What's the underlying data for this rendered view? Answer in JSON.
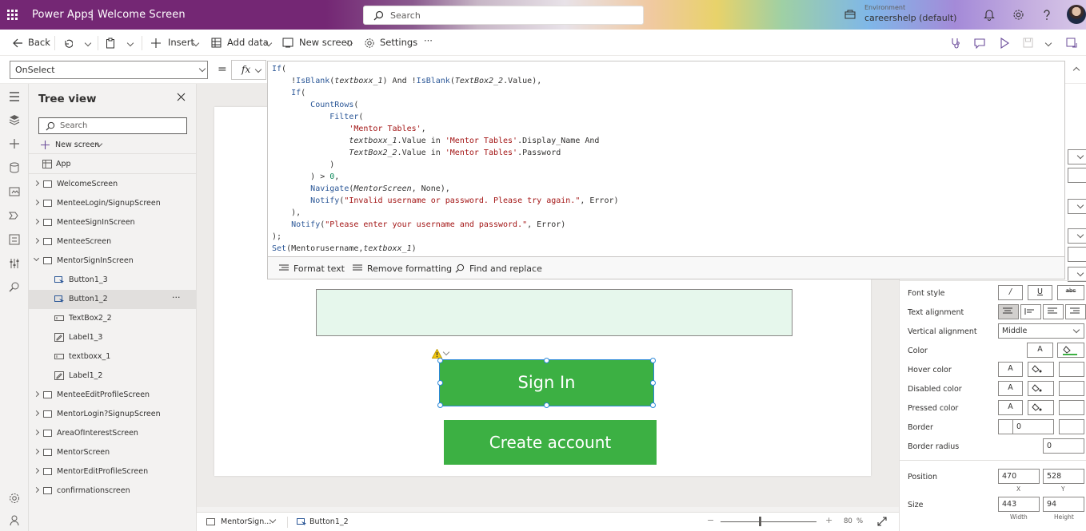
{
  "titlebar": {
    "app_name": "Power Apps",
    "separator": "|",
    "screen_name": "Welcome Screen",
    "search_placeholder": "Search",
    "environment_label": "Environment",
    "environment_value": "careershelp (default)"
  },
  "cmdbar": {
    "back": "Back",
    "insert": "Insert",
    "add_data": "Add data",
    "new_screen": "New screen",
    "settings": "Settings",
    "more": "···"
  },
  "formula": {
    "property": "OnSelect",
    "equals": "=",
    "fx": "fx",
    "format_text": "Format text",
    "remove_formatting": "Remove formatting",
    "find_replace": "Find and replace"
  },
  "tree": {
    "title": "Tree view",
    "search_placeholder": "Search",
    "new_screen": "New screen",
    "app": "App",
    "items": [
      {
        "label": "WelcomeScreen",
        "type": "screen"
      },
      {
        "label": "MenteeLogin/SignupScreen",
        "type": "screen"
      },
      {
        "label": "MenteeSignInScreen",
        "type": "screen"
      },
      {
        "label": "MenteeScreen",
        "type": "screen"
      },
      {
        "label": "MentorSignInScreen",
        "type": "screen-open"
      },
      {
        "label": "Button1_3",
        "type": "button"
      },
      {
        "label": "Button1_2",
        "type": "button",
        "selected": true
      },
      {
        "label": "TextBox2_2",
        "type": "textbox"
      },
      {
        "label": "Label1_3",
        "type": "label"
      },
      {
        "label": "textboxx_1",
        "type": "textbox"
      },
      {
        "label": "Label1_2",
        "type": "label"
      },
      {
        "label": "MenteeEditProfileScreen",
        "type": "screen"
      },
      {
        "label": "MentorLogin?SignupScreen",
        "type": "screen"
      },
      {
        "label": "AreaOfInterestScreen",
        "type": "screen"
      },
      {
        "label": "MentorScreen",
        "type": "screen"
      },
      {
        "label": "MentorEditProfileScreen",
        "type": "screen"
      },
      {
        "label": "confirmationscreen",
        "type": "screen"
      }
    ],
    "item_more": "···"
  },
  "canvas": {
    "signin_label": "Sign In",
    "create_label": "Create account"
  },
  "bottombar": {
    "screen": "MentorSign...",
    "control": "Button1_2",
    "zoom": "80",
    "zoom_unit": "%"
  },
  "properties": {
    "font_style": "Font style",
    "text_alignment": "Text alignment",
    "vertical_alignment": "Vertical alignment",
    "vertical_alignment_value": "Middle",
    "color": "Color",
    "hover_color": "Hover color",
    "disabled_color": "Disabled color",
    "pressed_color": "Pressed color",
    "border": "Border",
    "border_value": "0",
    "border_radius": "Border radius",
    "border_radius_value": "0",
    "position": "Position",
    "x": "470",
    "y": "528",
    "x_label": "X",
    "y_label": "Y",
    "size": "Size",
    "width": "443",
    "height": "94",
    "width_label": "Width",
    "height_label": "Height",
    "font_color_glyph": "A",
    "italic_glyph": "/",
    "underline_glyph": "U",
    "strike_glyph": "abc"
  },
  "colors": {
    "brand": "#742774",
    "button_green": "#3cb043",
    "textbox_fill": "#e6f7ec",
    "selection": "#2b88d8"
  },
  "code_lines": [
    "If(",
    "    !IsBlank(textboxx_1) And !IsBlank(TextBox2_2.Value),",
    "    If(",
    "        CountRows(",
    "            Filter(",
    "                'Mentor Tables',",
    "                textboxx_1.Value in 'Mentor Tables'.Display_Name And",
    "                TextBox2_2.Value in 'Mentor Tables'.Password",
    "            )",
    "        ) > 0,",
    "        Navigate(MentorScreen, None),",
    "        Notify(\"Invalid username or password. Please try again.\", Error)",
    "    ),",
    "    Notify(\"Please enter your username and password.\", Error)",
    ");",
    "Set(Mentorusername,textboxx_1)"
  ]
}
